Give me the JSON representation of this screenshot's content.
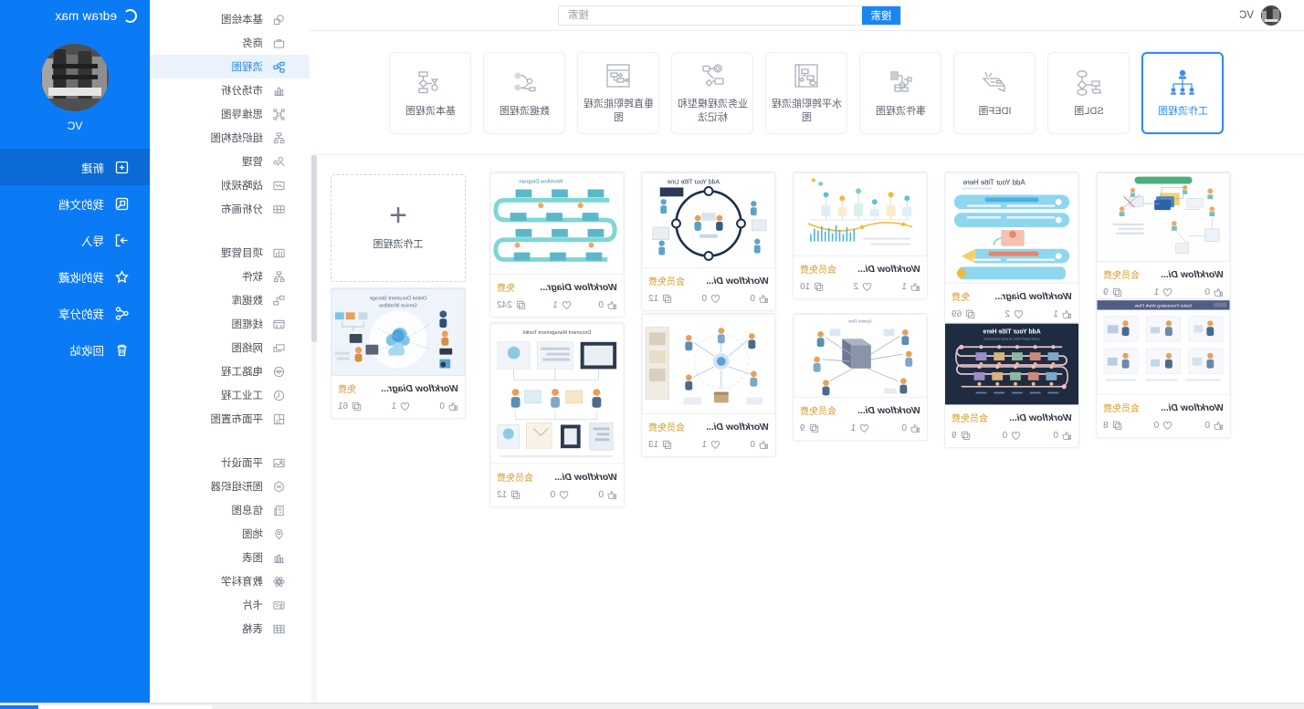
{
  "app": {
    "brand": "edraw max",
    "user_name": "VC",
    "mirrored": true
  },
  "rail": {
    "items": [
      {
        "label": "新建",
        "icon": "new-document-icon",
        "active": true
      },
      {
        "label": "我的文档",
        "icon": "my-documents-icon",
        "active": false
      },
      {
        "label": "导入",
        "icon": "import-icon",
        "active": false
      },
      {
        "label": "我的收藏",
        "icon": "star-icon",
        "active": false
      },
      {
        "label": "我的分享",
        "icon": "share-icon",
        "active": false
      },
      {
        "label": "回收站",
        "icon": "trash-icon",
        "active": false
      }
    ]
  },
  "categories": {
    "group_a": [
      {
        "label": "基本绘图",
        "icon": "basic-shapes-icon",
        "active": false
      },
      {
        "label": "商务",
        "icon": "briefcase-icon",
        "active": false
      },
      {
        "label": "流程图",
        "icon": "flowchart-icon",
        "active": true
      },
      {
        "label": "市场分析",
        "icon": "market-analysis-icon",
        "active": false
      },
      {
        "label": "思维导图",
        "icon": "mindmap-icon",
        "active": false
      },
      {
        "label": "组织结构图",
        "icon": "org-chart-icon",
        "active": false
      },
      {
        "label": "管理",
        "icon": "management-icon",
        "active": false
      },
      {
        "label": "战略规划",
        "icon": "strategy-icon",
        "active": false
      },
      {
        "label": "分析画布",
        "icon": "canvas-icon",
        "active": false
      }
    ],
    "group_b": [
      {
        "label": "项目管理",
        "icon": "project-management-icon",
        "active": false
      },
      {
        "label": "软件",
        "icon": "software-icon",
        "active": false
      },
      {
        "label": "数据库",
        "icon": "database-icon",
        "active": false
      },
      {
        "label": "线框图",
        "icon": "wireframe-icon",
        "active": false
      },
      {
        "label": "网络图",
        "icon": "network-icon",
        "active": false
      },
      {
        "label": "电路工程",
        "icon": "circuit-icon",
        "active": false
      },
      {
        "label": "工业工程",
        "icon": "industrial-icon",
        "active": false
      },
      {
        "label": "平面布置图",
        "icon": "floorplan-icon",
        "active": false
      }
    ],
    "group_c": [
      {
        "label": "平面设计",
        "icon": "graphic-design-icon",
        "active": false
      },
      {
        "label": "图形组织器",
        "icon": "graphic-organizer-icon",
        "active": false
      },
      {
        "label": "信息图",
        "icon": "infographic-icon",
        "active": false
      },
      {
        "label": "地图",
        "icon": "map-pin-icon",
        "active": false
      },
      {
        "label": "图表",
        "icon": "bar-chart-icon",
        "active": false
      },
      {
        "label": "教育科学",
        "icon": "science-icon",
        "active": false
      },
      {
        "label": "卡片",
        "icon": "card-icon",
        "active": false
      },
      {
        "label": "表格",
        "icon": "table-icon",
        "active": false
      }
    ]
  },
  "search": {
    "button_label": "搜索",
    "placeholder": "搜索",
    "value": ""
  },
  "type_tabs": [
    {
      "label": "工作流程图",
      "icon": "workflow-icon",
      "active": true
    },
    {
      "label": "SDL图",
      "icon": "sdl-icon",
      "active": false
    },
    {
      "label": "IDEF图",
      "icon": "idef-icon",
      "active": false
    },
    {
      "label": "事件流程图",
      "icon": "event-flow-icon",
      "active": false
    },
    {
      "label": "水平跨职能流程图",
      "icon": "horizontal-swimlane-icon",
      "active": false
    },
    {
      "label": "业务流程模型和标记法",
      "icon": "bpmn-icon",
      "active": false
    },
    {
      "label": "垂直跨职能流程图",
      "icon": "vertical-swimlane-icon",
      "active": false
    },
    {
      "label": "数据流程图",
      "icon": "dataflow-icon",
      "active": false
    },
    {
      "label": "基本流程图",
      "icon": "basic-flowchart-icon",
      "active": false
    }
  ],
  "new_card": {
    "label": "工作流程图",
    "plus": "+"
  },
  "templates": [
    {
      "title": "Workflow Di...",
      "badge": "会员免费",
      "likes": "0",
      "hearts": "1",
      "copies": "9",
      "thumb": "green-banner-flow"
    },
    {
      "title": "Workflow Diagr...",
      "badge": "免费",
      "likes": "1",
      "hearts": "2",
      "copies": "69",
      "thumb": "blue-steps-flow"
    },
    {
      "title": "Workflow Di...",
      "badge": "会员免费",
      "likes": "1",
      "hearts": "2",
      "copies": "10",
      "thumb": "timeline-bars-flow"
    },
    {
      "title": "Workflow Di...",
      "badge": "会员免费",
      "likes": "0",
      "hearts": "0",
      "copies": "12",
      "thumb": "circle-loop-flow"
    },
    {
      "title": "Workflow Diagr...",
      "badge": "免费",
      "likes": "0",
      "hearts": "1",
      "copies": "242",
      "thumb": "teal-snake-flow"
    },
    {
      "title": "Workflow Diagr...",
      "badge": "免费",
      "likes": "0",
      "hearts": "1",
      "copies": "61",
      "thumb": "cloud-service-flow"
    },
    {
      "title": "Workflow Di...",
      "badge": "会员免费",
      "likes": "0",
      "hearts": "0",
      "copies": "8",
      "thumb": "purple-grid-flow"
    },
    {
      "title": "Workflow Di...",
      "badge": "会员免费",
      "likes": "0",
      "hearts": "0",
      "copies": "9",
      "thumb": "dark-timeline-flow"
    },
    {
      "title": "Workflow Di...",
      "badge": "会员免费",
      "likes": "0",
      "hearts": "1",
      "copies": "9",
      "thumb": "server-hub-flow"
    },
    {
      "title": "Workflow Di...",
      "badge": "会员免费",
      "likes": "0",
      "hearts": "1",
      "copies": "13",
      "thumb": "radial-people-flow"
    },
    {
      "title": "Workflow Di...",
      "badge": "会员免费",
      "likes": "0",
      "hearts": "0",
      "copies": "12",
      "thumb": "doc-mgmt-toolkit-flow"
    }
  ],
  "colors": {
    "brand_blue": "#0b7bf5",
    "accent_blue": "#2684f0",
    "active_rail": "#0a6ad6",
    "badge_gold": "#d89b2c",
    "text_dark": "#303641",
    "text_muted": "#8b929c"
  }
}
